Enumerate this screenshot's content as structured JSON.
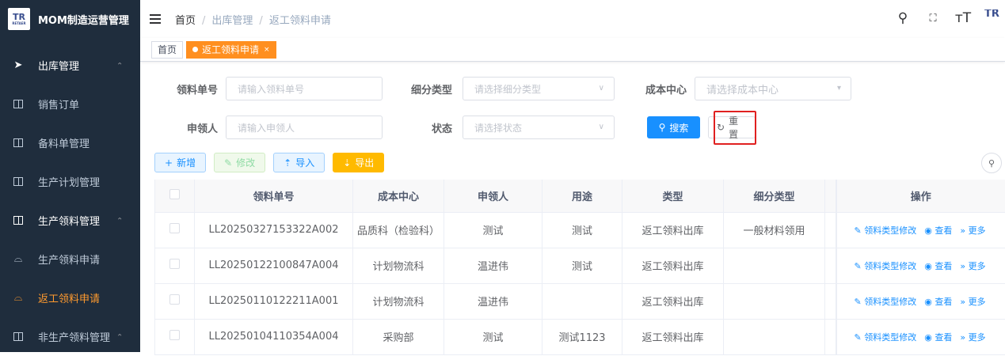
{
  "app": {
    "title": "MOM制造运营管理",
    "logo_text": "TR",
    "logo_sub": "RETAER"
  },
  "sidebar": {
    "items": [
      {
        "label": "出库管理",
        "icon": "send-icon",
        "expanded": true
      },
      {
        "label": "销售订单",
        "icon": "book-icon"
      },
      {
        "label": "备料单管理",
        "icon": "book-icon"
      },
      {
        "label": "生产计划管理",
        "icon": "book-icon"
      },
      {
        "label": "生产领料管理",
        "icon": "book-icon",
        "expanded": true
      },
      {
        "label": "生产领料申请",
        "icon": "headset-icon"
      },
      {
        "label": "返工领料申请",
        "icon": "headset-icon",
        "active": true
      },
      {
        "label": "非生产领料管理",
        "icon": "book-icon",
        "expanded": true
      }
    ]
  },
  "breadcrumb": {
    "home": "首页",
    "level1": "出库管理",
    "level2": "返工领料申请",
    "sep": "/"
  },
  "tags": {
    "home": "首页",
    "current": "返工领料申请",
    "close": "×"
  },
  "search": {
    "order_no_label": "领料单号",
    "order_no_placeholder": "请输入领料单号",
    "sub_type_label": "细分类型",
    "sub_type_placeholder": "请选择细分类型",
    "cost_center_label": "成本中心",
    "cost_center_placeholder": "请选择成本中心",
    "applicant_label": "申领人",
    "applicant_placeholder": "请输入申领人",
    "status_label": "状态",
    "status_placeholder": "请选择状态",
    "search_btn": "搜索",
    "reset_btn": "重置"
  },
  "toolbar": {
    "add": "新增",
    "edit": "修改",
    "import": "导入",
    "export": "导出"
  },
  "table": {
    "headers": [
      "领料单号",
      "成本中心",
      "申领人",
      "用途",
      "类型",
      "细分类型",
      "操作"
    ],
    "rows": [
      {
        "no": "LL20250327153322A002",
        "cost_center": "品质科（检验科）",
        "applicant": "测试",
        "purpose": "测试",
        "type": "返工领料出库",
        "sub_type": "一般材料领用"
      },
      {
        "no": "LL20250122100847A004",
        "cost_center": "计划物流科",
        "applicant": "温进伟",
        "purpose": "测试",
        "type": "返工领料出库",
        "sub_type": ""
      },
      {
        "no": "LL20250110122211A001",
        "cost_center": "计划物流科",
        "applicant": "温进伟",
        "purpose": "",
        "type": "返工领料出库",
        "sub_type": ""
      },
      {
        "no": "LL20250104110354A004",
        "cost_center": "采购部",
        "applicant": "测试",
        "purpose": "测试1123",
        "type": "返工领料出库",
        "sub_type": ""
      }
    ],
    "ops": {
      "type_edit": "领料类型修改",
      "view": "查看",
      "more": "更多"
    }
  },
  "colors": {
    "sidebar_bg": "#1f2d3d",
    "accent": "#ff8f1f",
    "primary": "#1890ff",
    "highlight": "#e02020"
  }
}
